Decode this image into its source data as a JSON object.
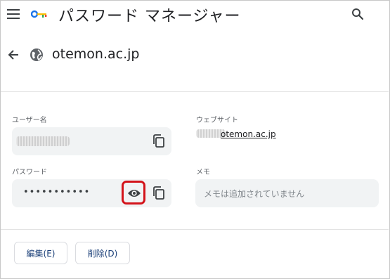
{
  "header": {
    "title": "パスワード マネージャー",
    "menu_icon": "hamburger-menu-icon",
    "logo_icon": "password-manager-key-icon",
    "search_icon": "search-icon"
  },
  "site": {
    "name": "otemon.ac.jp",
    "back_icon": "back-arrow-icon",
    "favicon": "globe-icon"
  },
  "fields": {
    "username": {
      "label": "ユーザー名",
      "value_blurred": true
    },
    "website": {
      "label": "ウェブサイト",
      "value": "otemon.ac.jp"
    },
    "password": {
      "label": "パスワード",
      "value": "•••••••••••"
    },
    "memo": {
      "label": "メモ",
      "placeholder": "メモは追加されていません"
    }
  },
  "actions": {
    "edit_label": "編集(E)",
    "delete_label": "削除(D)"
  },
  "colors": {
    "accent_text": "#1a3f78",
    "highlight_border": "#d3131a",
    "field_bg": "#f1f3f4"
  }
}
